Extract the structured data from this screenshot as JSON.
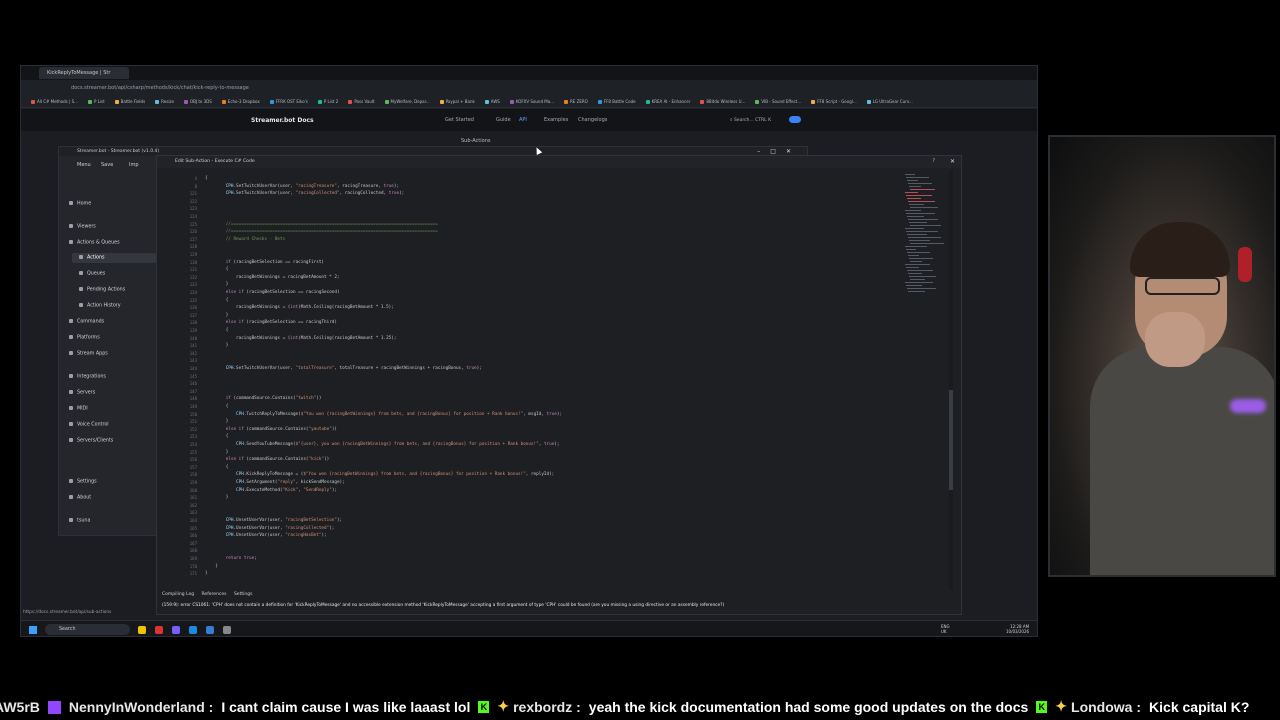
{
  "browser": {
    "tab_title": "KickReplyToMessage | Str",
    "url": "docs.streamer.bot/api/csharp/methods/kick/chat/kick-reply-to-message",
    "bookmarks": [
      "All C# Methods | S...",
      "P List",
      "Battle Fields",
      "Resize",
      "OBJ to 3DS",
      "Echo-3 Dropbox",
      "FFRK OST Eiko's",
      "P List 2",
      "Pass Vault",
      "MyWelfare, Depar...",
      "Paypal + Bank",
      "AWS",
      "KOFXV Sound Ma...",
      "RE ZERO",
      "FF8 Battle Code",
      "KREA AI - Enhancer",
      "8Bitdo Wireless U...",
      "VIB - Sound Effect...",
      "FF8 Script - Googl...",
      "LG UltraGear Curv..."
    ]
  },
  "docs_nav": {
    "logo": "Streamer.bot Docs",
    "items": [
      "Get Started",
      "Guide",
      "API",
      "Examples",
      "Changelogs"
    ],
    "search": "Search...",
    "shortcut": "CTRL K",
    "sub_actions": "Sub-Actions"
  },
  "app": {
    "title": "Streamer.bot - Streamer.bot (v1.0.4)",
    "toolbar": [
      "Menu",
      "Save",
      "Imp"
    ],
    "sidebar": [
      "Home",
      "Viewers",
      "Actions & Queues",
      "Actions",
      "Queues",
      "Pending Actions",
      "Action History",
      "Commands",
      "Platforms",
      "Stream Apps",
      "Integrations",
      "Servers",
      "MIDI",
      "Voice Control",
      "Servers/Clients",
      "Settings",
      "About",
      "tsuna"
    ]
  },
  "editor": {
    "title": "Edit Sub-Action - Execute C# Code",
    "help": "?",
    "close": "✕",
    "lines": [
      {
        "n": "4",
        "t": "{"
      },
      {
        "n": "8",
        "t": "        CPH.SetTwitchUserVar(user, \"racingTreasure\", racingTreasure, true);"
      },
      {
        "n": "121",
        "t": "        CPH.SetTwitchUserVar(user, \"racingCollected\", racingCollected, true);"
      },
      {
        "n": "122",
        "t": ""
      },
      {
        "n": "123",
        "t": ""
      },
      {
        "n": "124",
        "t": ""
      },
      {
        "n": "125",
        "t": "        //================================================================================"
      },
      {
        "n": "126",
        "t": "        //================================================================================"
      },
      {
        "n": "127",
        "t": "        // Reward Checks - Bets"
      },
      {
        "n": "128",
        "t": ""
      },
      {
        "n": "129",
        "t": ""
      },
      {
        "n": "130",
        "t": "        if (racingBetSelection == racingFirst)"
      },
      {
        "n": "131",
        "t": "        {"
      },
      {
        "n": "132",
        "t": "            racingBetWinnings = racingBetAmount * 2;"
      },
      {
        "n": "133",
        "t": "        }"
      },
      {
        "n": "134",
        "t": "        else if (racingBetSelection == racingSecond)"
      },
      {
        "n": "135",
        "t": "        {"
      },
      {
        "n": "136",
        "t": "            racingBetWinnings = (int)Math.Ceiling(racingBetAmount * 1.5);"
      },
      {
        "n": "137",
        "t": "        }"
      },
      {
        "n": "138",
        "t": "        else if (racingBetSelection == racingThird)"
      },
      {
        "n": "139",
        "t": "        {"
      },
      {
        "n": "140",
        "t": "            racingBetWinnings = (int)Math.Ceiling(racingBetAmount * 1.25);"
      },
      {
        "n": "141",
        "t": "        }"
      },
      {
        "n": "142",
        "t": ""
      },
      {
        "n": "143",
        "t": ""
      },
      {
        "n": "144",
        "t": "        CPH.SetTwitchUserVar(user, \"totalTreasure\", totalTreasure + racingBetWinnings + racingBonus, true);"
      },
      {
        "n": "145",
        "t": ""
      },
      {
        "n": "146",
        "t": ""
      },
      {
        "n": "147",
        "t": ""
      },
      {
        "n": "148",
        "t": "        if (commandSource.Contains(\"twitch\"))"
      },
      {
        "n": "149",
        "t": "        {"
      },
      {
        "n": "150",
        "t": "            CPH.TwitchReplyToMessage($\"You won {racingBetWinnings} from bets, and {racingBonus} for position + Rank bonus!\", msgId, true);"
      },
      {
        "n": "151",
        "t": "        }"
      },
      {
        "n": "152",
        "t": "        else if (commandSource.Contains(\"youtube\"))"
      },
      {
        "n": "153",
        "t": "        {"
      },
      {
        "n": "154",
        "t": "            CPH.SendYouTubeMessage($\"{user}, you won {racingBetWinnings} from bets, and {racingBonus} for position + Rank bonus!\", true);"
      },
      {
        "n": "155",
        "t": "        }"
      },
      {
        "n": "156",
        "t": "        else if (commandSource.Contains(\"kick\"))"
      },
      {
        "n": "157",
        "t": "        {"
      },
      {
        "n": "158",
        "t": "            CPH.KickReplyToMessage = ($\"You won {racingBetWinnings} from bets, and {racingBonus} for position + Rank bonus!\", replyId);"
      },
      {
        "n": "159",
        "t": "            CPH.SetArgument(\"reply\", kickSendMessage);"
      },
      {
        "n": "160",
        "t": "            CPH.ExecuteMethod(\"Kick\", \"SendReply\");"
      },
      {
        "n": "161",
        "t": "        }"
      },
      {
        "n": "162",
        "t": ""
      },
      {
        "n": "163",
        "t": ""
      },
      {
        "n": "164",
        "t": "        CPH.UnsetUserVar(user, \"racingBetSelection\");"
      },
      {
        "n": "165",
        "t": "        CPH.UnsetUserVar(user, \"racingCollected\");"
      },
      {
        "n": "166",
        "t": "        CPH.UnsetUserVar(user, \"racingHasBet\");"
      },
      {
        "n": "167",
        "t": ""
      },
      {
        "n": "168",
        "t": ""
      },
      {
        "n": "169",
        "t": "        return true;"
      },
      {
        "n": "170",
        "t": "    }"
      },
      {
        "n": "171",
        "t": "}"
      }
    ],
    "bottom_tabs": [
      "Compiling Log",
      "References",
      "Settings"
    ],
    "error": "(159:9): error CS1061: 'CPH' does not contain a definition for 'KickReplyToMessage' and no accessible extension method 'KickReplyToMessage' accepting a first argument of type 'CPH' could be found (are you missing a using directive or an assembly reference?)"
  },
  "status_url": "https://docs.streamer.bot/api/sub-actions",
  "taskbar": {
    "search": "Search",
    "tray_lang": "ENG",
    "tray_region": "UK",
    "time": "12:28 AM",
    "date": "10/03/2026"
  },
  "ticker": [
    {
      "platform": "text",
      "user": "AW5rB",
      "msg": ""
    },
    {
      "platform": "twitch",
      "user": "NennyInWonderland",
      "msg": "I cant claim cause I was like laaast lol"
    },
    {
      "platform": "kick",
      "user": "rexbordz",
      "msg": "yeah the kick documentation had some good updates on the docs"
    },
    {
      "platform": "kick",
      "user": "Londowa",
      "msg": "Kick capital K?"
    }
  ],
  "colors": {
    "accent": "#3b82f6",
    "kick": "#53fc18",
    "twitch": "#9146ff",
    "error": "#e8e8e8"
  }
}
